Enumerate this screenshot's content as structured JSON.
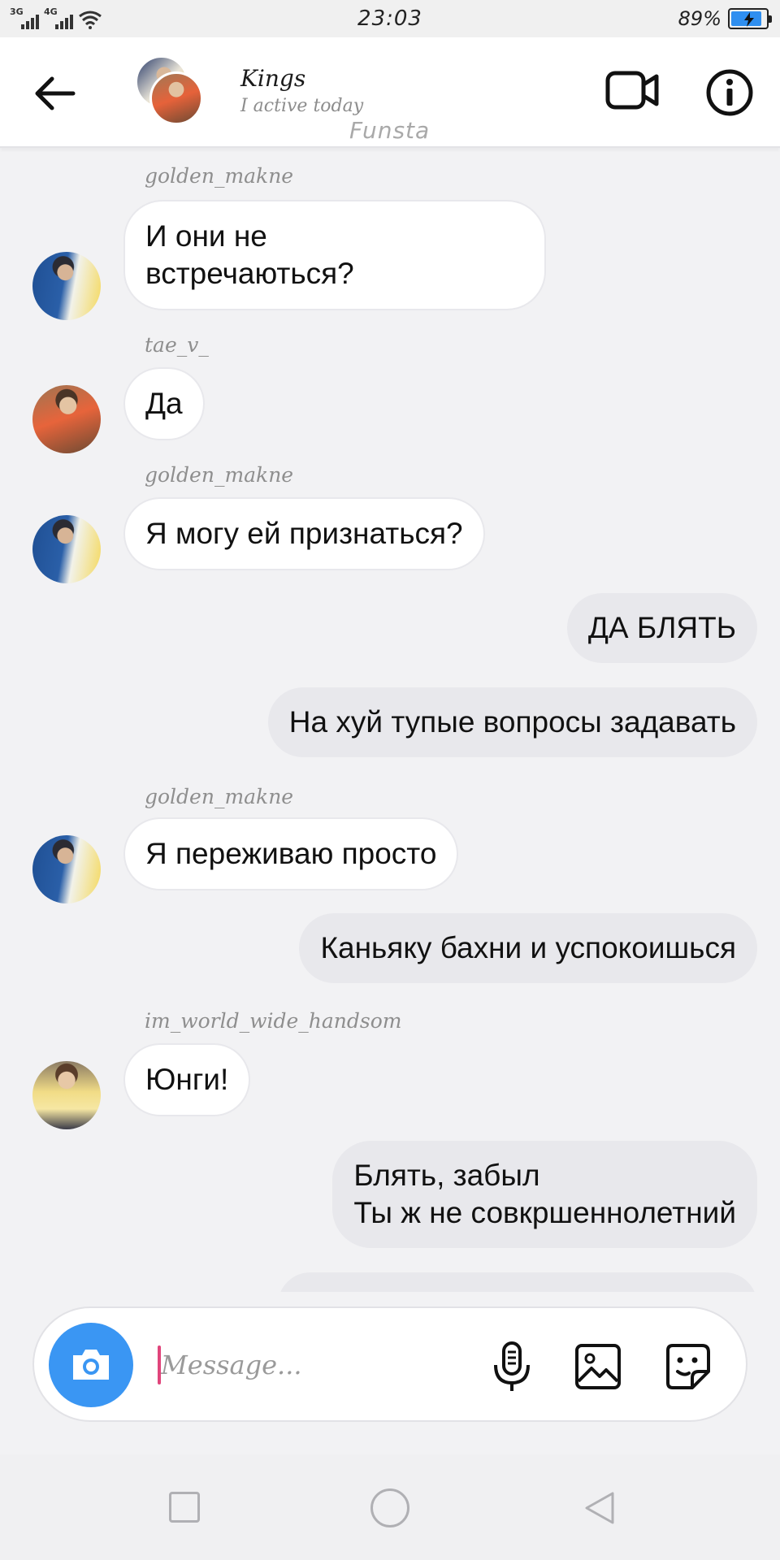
{
  "status_bar": {
    "sim1_label": "3G",
    "sim2_label": "4G",
    "time": "23:03",
    "battery_percent": "89%",
    "battery_level": 0.89
  },
  "header": {
    "title": "Kings",
    "status": "I active today",
    "watermark": "Funsta"
  },
  "messages": [
    {
      "direction": "in",
      "sender": "golden_makne",
      "avatar": "av-blue",
      "text": "И они не\nвстречаються?"
    },
    {
      "direction": "in",
      "sender": "tae_v_",
      "avatar": "av-orange",
      "text": "Да"
    },
    {
      "direction": "in",
      "sender": "golden_makne",
      "avatar": "av-blue",
      "text": "Я могу ей признаться?"
    },
    {
      "direction": "out",
      "text": "ДА БЛЯТЬ"
    },
    {
      "direction": "out",
      "text": "На хуй тупые вопросы задавать"
    },
    {
      "direction": "in",
      "sender": "golden_makne",
      "avatar": "av-blue",
      "text": "Я переживаю просто"
    },
    {
      "direction": "out",
      "text": "Каньяку бахни и успокоишься"
    },
    {
      "direction": "in",
      "sender": "im_world_wide_handsom",
      "avatar": "av-yellow",
      "text": "Юнги!"
    },
    {
      "direction": "out",
      "text": "Блять, забыл\nТы ж не совкршеннолетний"
    },
    {
      "direction": "out",
      "text": ""
    }
  ],
  "composer": {
    "placeholder": "Message...",
    "value": ""
  },
  "colors": {
    "accent": "#3a96f3",
    "caret": "#e0457b",
    "outgoing_bubble": "#e8e8ec"
  }
}
